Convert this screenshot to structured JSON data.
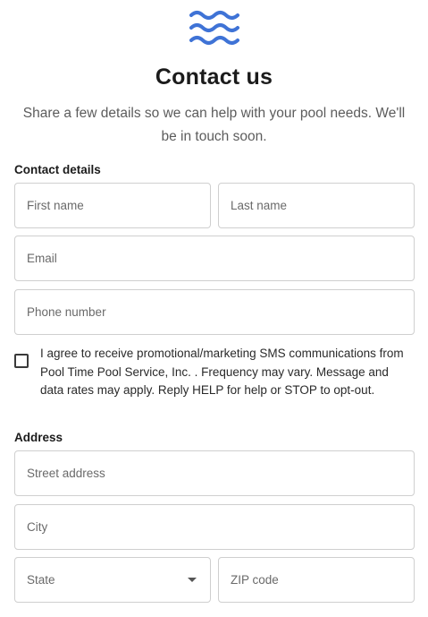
{
  "header": {
    "logo_icon": "waves-icon",
    "brand_color": "#3f73d6",
    "title": "Contact us",
    "subtitle": "Share a few details so we can help with your pool needs. We'll be in touch soon."
  },
  "contact_section": {
    "label": "Contact details",
    "first_name_placeholder": "First name",
    "last_name_placeholder": "Last name",
    "email_placeholder": "Email",
    "phone_placeholder": "Phone number"
  },
  "consent": {
    "checked": false,
    "text": "I agree to receive promotional/marketing SMS communications from Pool Time Pool Service, Inc. . Frequency may vary. Message and data rates may apply. Reply HELP for help or STOP to opt-out."
  },
  "address_section": {
    "label": "Address",
    "street_placeholder": "Street address",
    "city_placeholder": "City",
    "state_placeholder": "State",
    "zip_placeholder": "ZIP code"
  }
}
